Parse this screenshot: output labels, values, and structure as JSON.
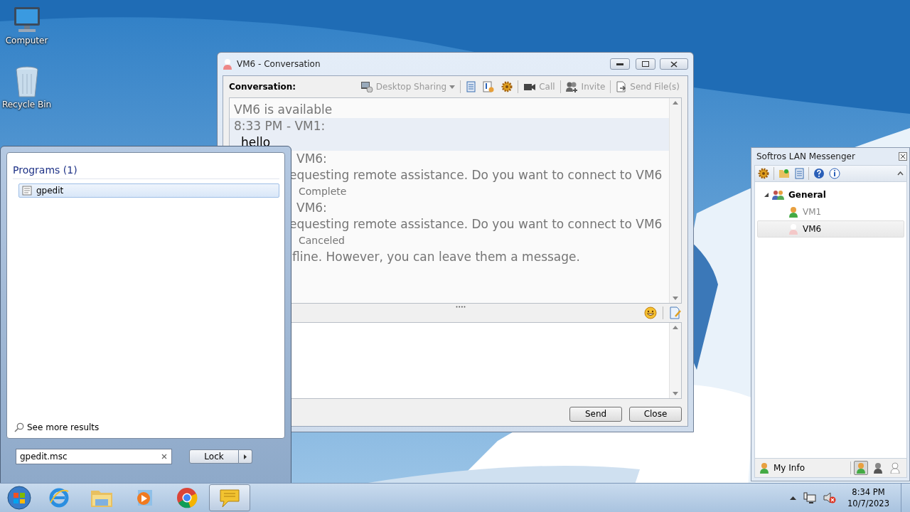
{
  "desktop": {
    "icons": [
      {
        "kind": "computer",
        "label": "Computer"
      },
      {
        "kind": "recycle-bin",
        "label": "Recycle Bin"
      }
    ]
  },
  "conversation": {
    "title": "VM6 - Conversation",
    "heading": "Conversation:",
    "toolbar": [
      {
        "kind": "desktop-sharing",
        "label": "Desktop Sharing",
        "disabled": true
      },
      {
        "kind": "separator"
      },
      {
        "kind": "history"
      },
      {
        "kind": "contact-info"
      },
      {
        "kind": "settings"
      },
      {
        "kind": "separator"
      },
      {
        "kind": "call",
        "label": "Call",
        "disabled": true
      },
      {
        "kind": "separator"
      },
      {
        "kind": "invite",
        "label": "Invite",
        "disabled": true
      },
      {
        "kind": "separator"
      },
      {
        "kind": "send-file",
        "label": "Send File(s)",
        "disabled": true
      }
    ],
    "messages": [
      {
        "kind": "status",
        "text": "VM6 is available"
      },
      {
        "kind": "chat",
        "header": "8:33 PM - VM1:",
        "lines": [
          "hello"
        ],
        "highlighted": true
      },
      {
        "kind": "request_partial",
        "header": "VM6:",
        "lines": [
          "equesting remote assistance. Do you want to connect to VM6"
        ],
        "result": "Complete",
        "highlighted": false
      },
      {
        "kind": "request_partial",
        "header": "VM6:",
        "lines": [
          "equesting remote assistance. Do you want to connect to VM6"
        ],
        "result": "Canceled",
        "highlighted": false
      },
      {
        "kind": "status_partial",
        "text": "fline. However, you can leave them a message."
      }
    ],
    "buttons": [
      {
        "label": "Send"
      },
      {
        "label": "Close"
      }
    ]
  },
  "start_menu": {
    "section": "Programs (1)",
    "results": [
      {
        "label": "gpedit",
        "selected": true
      }
    ],
    "more_link": "See more results",
    "search": {
      "value": "gpedit.msc"
    },
    "power_button": "Lock"
  },
  "messenger": {
    "title": "Softros LAN Messenger",
    "tree": [
      {
        "label": "General",
        "expanded": true,
        "children": [
          {
            "label": "VM1",
            "selected": false,
            "kind": "self"
          },
          {
            "label": "VM6",
            "selected": true,
            "kind": "offline"
          }
        ]
      }
    ],
    "footer": "My Info",
    "status_buttons": [
      {
        "kind": "available",
        "selected": true
      },
      {
        "kind": "busy",
        "selected": false
      },
      {
        "kind": "offline",
        "selected": false
      }
    ]
  },
  "taskbar": {
    "apps": [
      {
        "kind": "e-logo",
        "active": false
      },
      {
        "kind": "folder",
        "active": false
      },
      {
        "kind": "media-player",
        "active": false
      },
      {
        "kind": "round-logo",
        "active": false
      },
      {
        "kind": "speech-bubble",
        "active": true
      }
    ],
    "clock": {
      "time": "8:34 PM",
      "date": "10/7/2023"
    }
  }
}
